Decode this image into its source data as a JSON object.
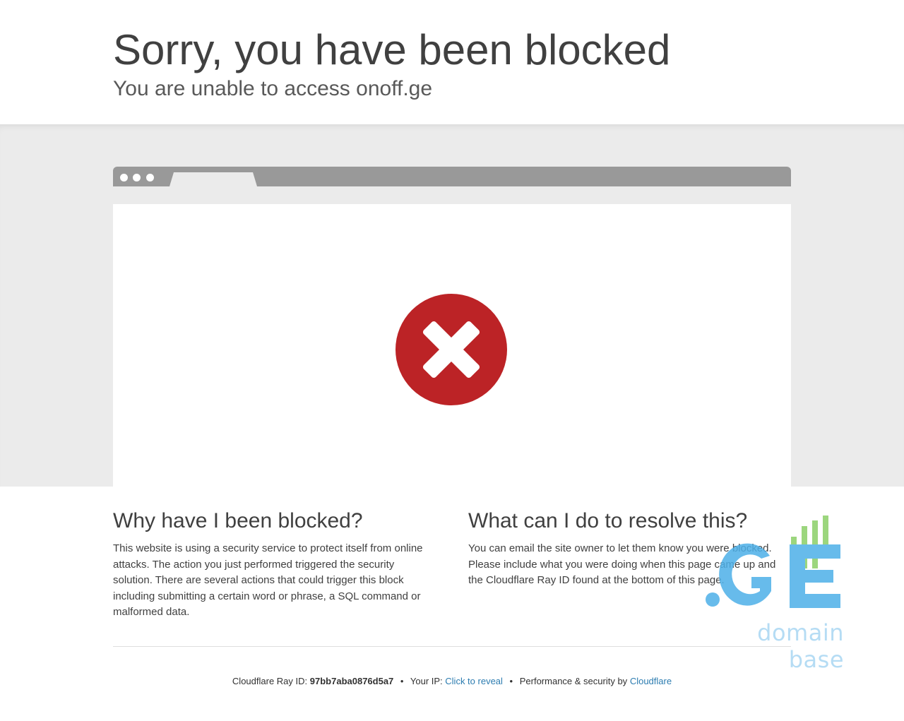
{
  "header": {
    "title": "Sorry, you have been blocked",
    "subtitle": "You are unable to access onoff.ge"
  },
  "icon": {
    "name": "blocked-x-icon",
    "color": "#bc2326"
  },
  "why": {
    "heading": "Why have I been blocked?",
    "body": "This website is using a security service to protect itself from online attacks. The action you just performed triggered the security solution. There are several actions that could trigger this block including submitting a certain word or phrase, a SQL command or malformed data."
  },
  "resolve": {
    "heading": "What can I do to resolve this?",
    "body": "You can email the site owner to let them know you were blocked. Please include what you were doing when this page came up and the Cloudflare Ray ID found at the bottom of this page."
  },
  "footer": {
    "ray_label": "Cloudflare Ray ID:",
    "ray_id": "97bb7aba0876d5a7",
    "ip_label": "Your IP:",
    "ip_link": "Click to reveal",
    "perf_label": "Performance & security by",
    "perf_link": "Cloudflare",
    "separator": "•"
  },
  "watermark": {
    "logo_text": ".GE",
    "caption": "domain base",
    "colors": {
      "blue": "#4db0e8",
      "green": "#8bd068"
    }
  }
}
